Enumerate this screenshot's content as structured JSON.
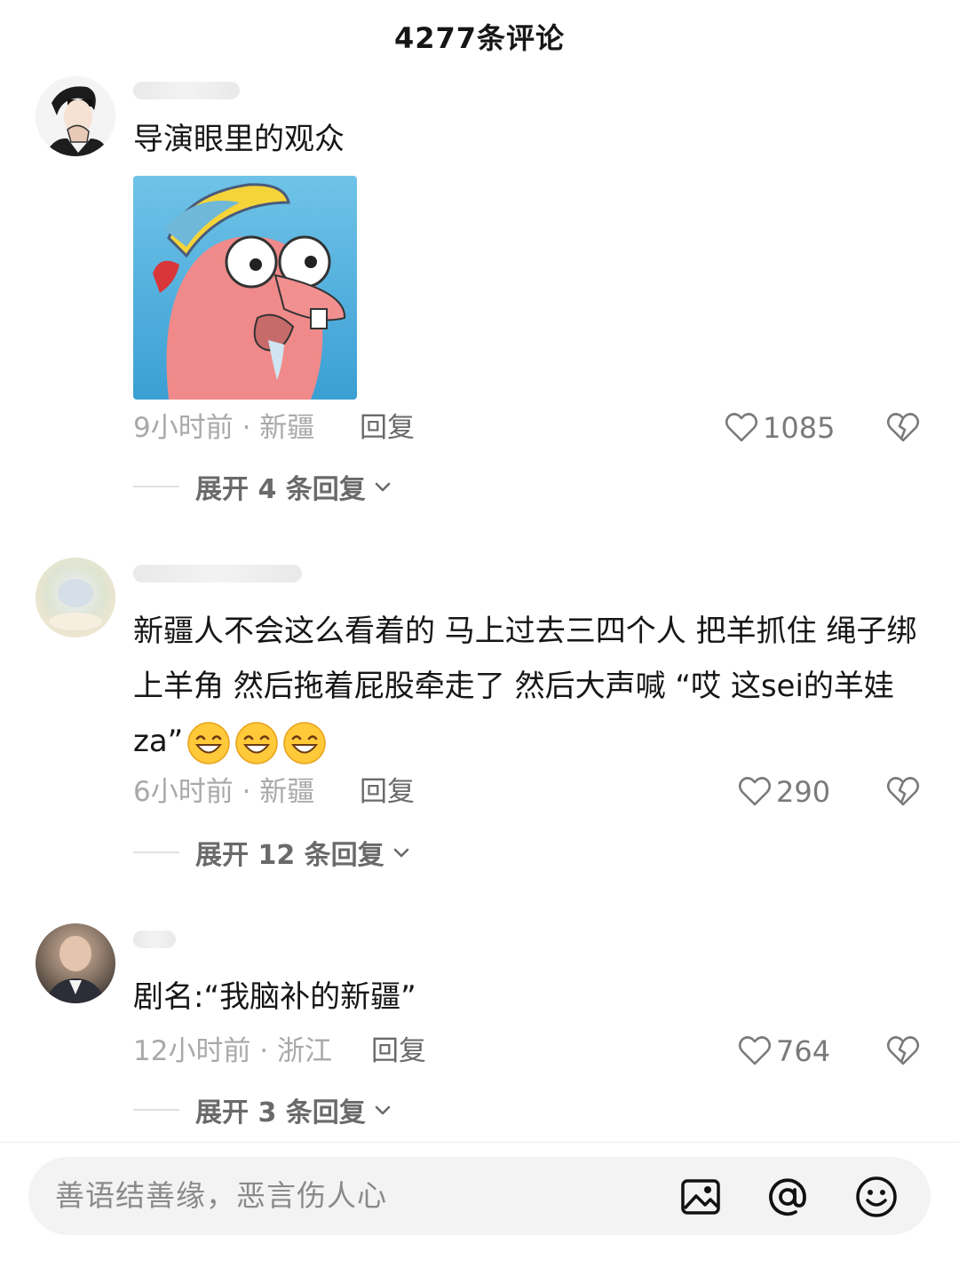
{
  "header": {
    "title": "4277条评论"
  },
  "comments": [
    {
      "text": "导演眼里的观众",
      "time": "9小时前",
      "location": "新疆",
      "meta_sep": " · ",
      "reply_label": "回复",
      "likes": "1085",
      "expand_label": "展开 4 条回复"
    },
    {
      "text": "新疆人不会这么看着的 马上过去三四个人 把羊抓住 绳子绑上羊角 然后拖着屁股牵走了 然后大声喊 “哎 这sei的羊娃za”",
      "time": "6小时前",
      "location": "新疆",
      "meta_sep": " · ",
      "reply_label": "回复",
      "likes": "290",
      "expand_label": "展开 12 条回复"
    },
    {
      "text": "剧名:“我脑补的新疆”",
      "time": "12小时前",
      "location": "浙江",
      "meta_sep": " · ",
      "reply_label": "回复",
      "likes": "764",
      "expand_label": "展开 3 条回复"
    }
  ],
  "composer": {
    "placeholder": "善语结善缘，恶言伤人心"
  },
  "icons": {
    "like": "heart-outline-icon",
    "dislike": "broken-heart-icon",
    "expand": "chevron-down-icon",
    "image": "image-icon",
    "mention": "at-icon",
    "emoji": "smiley-icon"
  }
}
